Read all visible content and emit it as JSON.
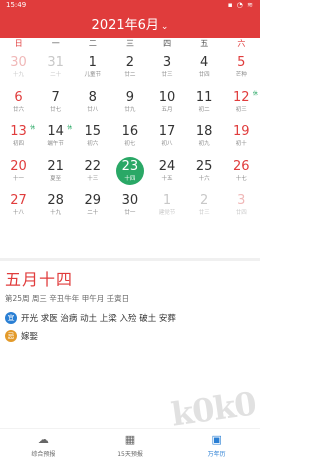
{
  "status": {
    "time": "15:49",
    "icons": "▪ ◔ ≋"
  },
  "header": {
    "title": "2021年6月",
    "caret": "⌄"
  },
  "weekdays": [
    {
      "label": "日",
      "weekend": true
    },
    {
      "label": "一",
      "weekend": false
    },
    {
      "label": "二",
      "weekend": false
    },
    {
      "label": "三",
      "weekend": false
    },
    {
      "label": "四",
      "weekend": false
    },
    {
      "label": "五",
      "weekend": false
    },
    {
      "label": "六",
      "weekend": true
    }
  ],
  "calendar": {
    "rows": [
      [
        {
          "day": "30",
          "lunar": "十九",
          "other": true
        },
        {
          "day": "31",
          "lunar": "二十",
          "other": true
        },
        {
          "day": "1",
          "lunar": "儿童节"
        },
        {
          "day": "2",
          "lunar": "廿二"
        },
        {
          "day": "3",
          "lunar": "廿三"
        },
        {
          "day": "4",
          "lunar": "廿四"
        },
        {
          "day": "5",
          "lunar": "芒种"
        }
      ],
      [
        {
          "day": "6",
          "lunar": "廿六"
        },
        {
          "day": "7",
          "lunar": "廿七"
        },
        {
          "day": "8",
          "lunar": "廿八"
        },
        {
          "day": "9",
          "lunar": "廿九"
        },
        {
          "day": "10",
          "lunar": "五月"
        },
        {
          "day": "11",
          "lunar": "初二"
        },
        {
          "day": "12",
          "lunar": "初三",
          "badge": "休"
        }
      ],
      [
        {
          "day": "13",
          "lunar": "初四",
          "badge": "休"
        },
        {
          "day": "14",
          "lunar": "端午节",
          "badge": "休"
        },
        {
          "day": "15",
          "lunar": "初六"
        },
        {
          "day": "16",
          "lunar": "初七"
        },
        {
          "day": "17",
          "lunar": "初八"
        },
        {
          "day": "18",
          "lunar": "初九"
        },
        {
          "day": "19",
          "lunar": "初十"
        }
      ],
      [
        {
          "day": "20",
          "lunar": "十一"
        },
        {
          "day": "21",
          "lunar": "夏至"
        },
        {
          "day": "22",
          "lunar": "十三"
        },
        {
          "day": "23",
          "lunar": "十四",
          "today": true
        },
        {
          "day": "24",
          "lunar": "十五"
        },
        {
          "day": "25",
          "lunar": "十六"
        },
        {
          "day": "26",
          "lunar": "十七"
        }
      ],
      [
        {
          "day": "27",
          "lunar": "十八"
        },
        {
          "day": "28",
          "lunar": "十九"
        },
        {
          "day": "29",
          "lunar": "二十"
        },
        {
          "day": "30",
          "lunar": "廿一"
        },
        {
          "day": "1",
          "lunar": "建党节",
          "other": true
        },
        {
          "day": "2",
          "lunar": "廿三",
          "other": true
        },
        {
          "day": "3",
          "lunar": "廿四",
          "other": true
        }
      ]
    ]
  },
  "detail": {
    "lunar_date": "五月十四",
    "ganzhi": "第25周 周三 辛丑牛年 甲午月 壬寅日",
    "yi_badge": "宜",
    "yi": "开光 求医 治病 动土 上梁 入殓 破土 安葬",
    "ji_badge": "忌",
    "ji": "嫁娶"
  },
  "tabs": [
    {
      "label": "综合预报",
      "icon": "☁",
      "icon_name": "weather-icon",
      "active": false
    },
    {
      "label": "15天预报",
      "icon": "▦",
      "icon_name": "forecast-icon",
      "active": false
    },
    {
      "label": "万年历",
      "icon": "▣",
      "icon_name": "calendar-icon",
      "active": true
    }
  ],
  "watermark": "k0k0",
  "colors": {
    "accent": "#e03c3c",
    "today": "#2aa866",
    "yi": "#2a7fd4",
    "ji": "#e39a2a"
  }
}
